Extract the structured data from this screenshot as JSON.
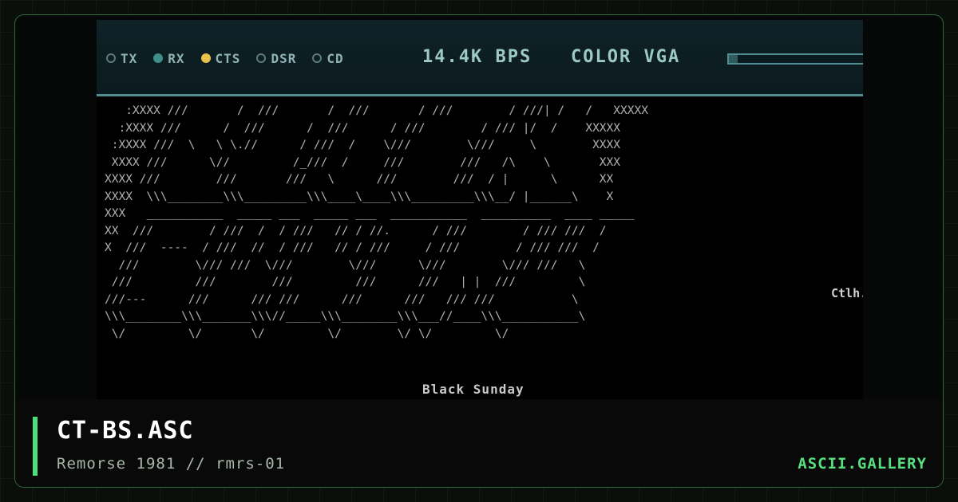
{
  "status_bar": {
    "indicators": [
      {
        "label": "TX",
        "state": "off"
      },
      {
        "label": "RX",
        "state": "on"
      },
      {
        "label": "CTS",
        "state": "on"
      },
      {
        "label": "DSR",
        "state": "off"
      },
      {
        "label": "CD",
        "state": "off"
      }
    ],
    "baud_rate": "14.4K BPS",
    "display_mode": "COLOR VGA",
    "progress": 0.06
  },
  "art": {
    "ascii": "   :XXXX ///       /  ///       /  ///       / ///        / ///| /   /   XXXXX\n  :XXXX ///      /  ///      /  ///      / ///        / /// |/  /    XXXXX\n :XXXX ///  \\   \\ \\.//      / ///  /    \\///        \\///     \\        XXXX\n XXXX ///      \\//         /_///  /     ///        ///   /\\    \\       XXX\nXXXX ///        ///       ///   \\      ///        ///  / |      \\      XX\nXXXX  \\\\\\________\\\\\\_________\\\\\\____\\____\\\\\\_________\\\\\\__/ |______\\    X\nXXX   ___________  _____ ___  _____ ___  ___________  __________  ____ _____\nXX  ///        / ///  /  / ///   // / //.      / ///        / /// ///  /\nX  ///  ----  / ///  //  / ///   // / ///     / ///        / /// ///  /\n  ///        \\/// ///  \\///        \\///      \\///        \\/// ///   \\  \n ///         ///        ///         ///      ///   | |  ///         \\\n///---      ///      /// ///      ///      ///   /// ///           \\\n\\\\\\________\\\\\\_______\\\\\\//_____\\\\\\________\\\\\\___//____\\\\\\___________\\\n \\/         \\/       \\/         \\/        \\/ \\/         \\/",
    "tag": "Ctlh.",
    "caption": "Black Sunday"
  },
  "info": {
    "title": "CT-BS.ASC",
    "subtitle": "Remorse 1981 // rmrs-01",
    "brand": "ASCII.GALLERY"
  },
  "colors": {
    "accent": "#4be07a",
    "status_text": "#9cc8c6",
    "led_rx": "#3e8f8a",
    "led_cts": "#e9c24a"
  }
}
